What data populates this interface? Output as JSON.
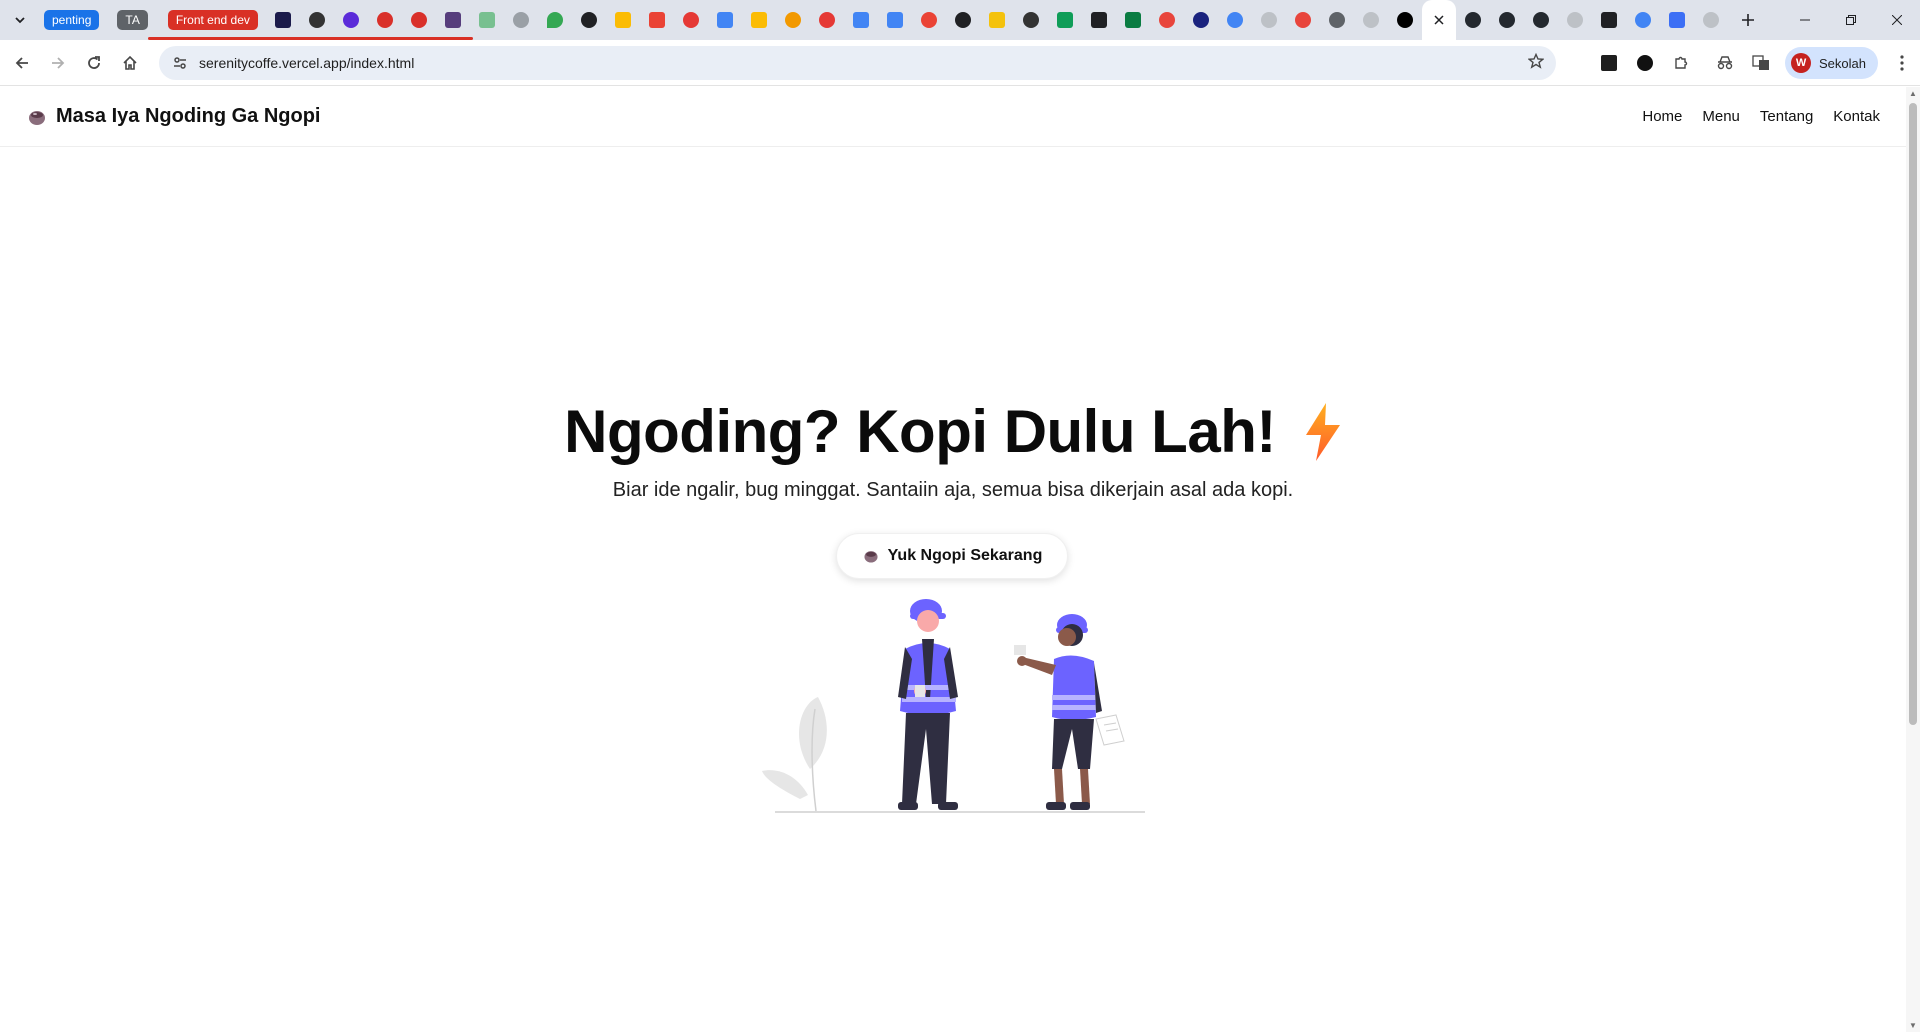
{
  "browser": {
    "tab_groups": [
      {
        "label": "penting",
        "color": "#1a73e8"
      },
      {
        "label": "TA",
        "color": "#5f6368"
      },
      {
        "label": "Front end dev",
        "color": "#d93025"
      }
    ],
    "new_tab_icon": "plus-icon",
    "url": "serenitycoffe.vercel.app/index.html",
    "profile_name": "Sekolah",
    "profile_initial": "W"
  },
  "site": {
    "brand": "Masa Iya Ngoding Ga Ngopi",
    "nav": [
      "Home",
      "Menu",
      "Tentang",
      "Kontak"
    ]
  },
  "hero": {
    "title": "Ngoding? Kopi Dulu Lah!",
    "subtitle": "Biar ide ngalir, bug minggat. Santaiin aja, semua bisa dikerjain asal ada kopi.",
    "cta": "Yuk Ngopi Sekarang"
  },
  "colors": {
    "accent": "#6c63ff",
    "text": "#0b0b0b"
  }
}
